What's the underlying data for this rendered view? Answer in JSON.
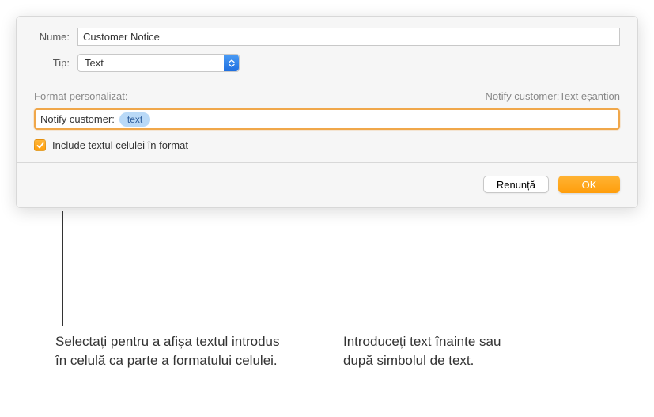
{
  "labels": {
    "name": "Nume:",
    "type": "Tip:",
    "custom_format": "Format personalizat:",
    "include_checkbox": "Include textul celulei în format"
  },
  "fields": {
    "name_value": "Customer Notice",
    "type_value": "Text",
    "format_prefix": "Notify customer:",
    "format_token": "text",
    "format_preview": "Notify customer:Text eșantion"
  },
  "buttons": {
    "cancel": "Renunță",
    "ok": "OK"
  },
  "callouts": {
    "left": "Selectați pentru a afișa textul introdus în celulă ca parte a formatului celulei.",
    "right": "Introduceți text înainte sau după simbolul de text."
  }
}
